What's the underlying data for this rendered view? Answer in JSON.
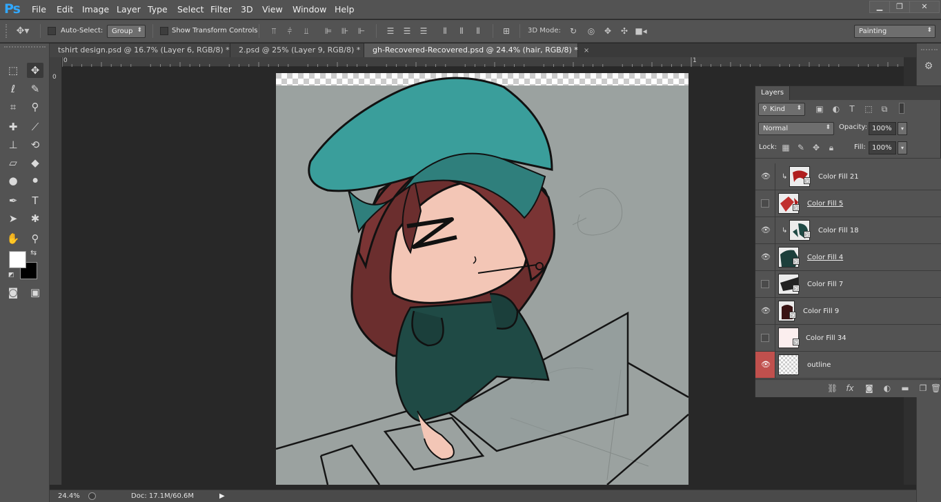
{
  "app": {
    "logo": "Ps"
  },
  "menu": [
    "File",
    "Edit",
    "Image",
    "Layer",
    "Type",
    "Select",
    "Filter",
    "3D",
    "View",
    "Window",
    "Help"
  ],
  "window_controls": {
    "minimize": "▁",
    "restore": "❐",
    "close": "✕"
  },
  "options": {
    "auto_select_label": "Auto-Select:",
    "auto_select_value": "Group",
    "show_transform_label": "Show Transform Controls",
    "mode3d_label": "3D Mode:",
    "workspace": "Painting"
  },
  "tabs": [
    {
      "label": "tshirt design.psd @ 16.7% (Layer 6, RGB/8) *",
      "close": "×"
    },
    {
      "label": "2.psd @ 25% (Layer 9, RGB/8) *",
      "close": "×"
    },
    {
      "label": "gh-Recovered-Recovered.psd @ 24.4% (hair, RGB/8) *",
      "close": "×"
    }
  ],
  "ruler": {
    "top_zero": "0",
    "top_one": "1",
    "left_zero": "0"
  },
  "status": {
    "zoom": "24.4%",
    "doc": "Doc: 17.1M/60.6M"
  },
  "layers_panel": {
    "tab": "Layers",
    "filter_kind": "Kind",
    "blend_mode": "Normal",
    "opacity_label": "Opacity:",
    "opacity_value": "100%",
    "lock_label": "Lock:",
    "fill_label": "Fill:",
    "fill_value": "100%",
    "layers": [
      {
        "name": "Color Fill 21",
        "visible": true,
        "clipped": true,
        "underline": false
      },
      {
        "name": "Color Fill 5",
        "visible": false,
        "clipped": false,
        "underline": true
      },
      {
        "name": "Color Fill 18",
        "visible": true,
        "clipped": true,
        "underline": false
      },
      {
        "name": "Color Fill 4",
        "visible": true,
        "clipped": false,
        "underline": true
      },
      {
        "name": "Color Fill 7",
        "visible": false,
        "clipped": false,
        "underline": false
      },
      {
        "name": "Color Fill 9",
        "visible": true,
        "clipped": false,
        "underline": false
      },
      {
        "name": "Color Fill 34",
        "visible": false,
        "clipped": false,
        "underline": false
      },
      {
        "name": "outline",
        "visible": true,
        "clipped": false,
        "underline": false
      }
    ]
  },
  "colors": {
    "accent_teal": "#3a9e9b",
    "hair": "#6b2e2e",
    "shirt": "#1f4a45",
    "skin": "#f3c6b6",
    "selected_eye_bg": "#c0504d"
  }
}
